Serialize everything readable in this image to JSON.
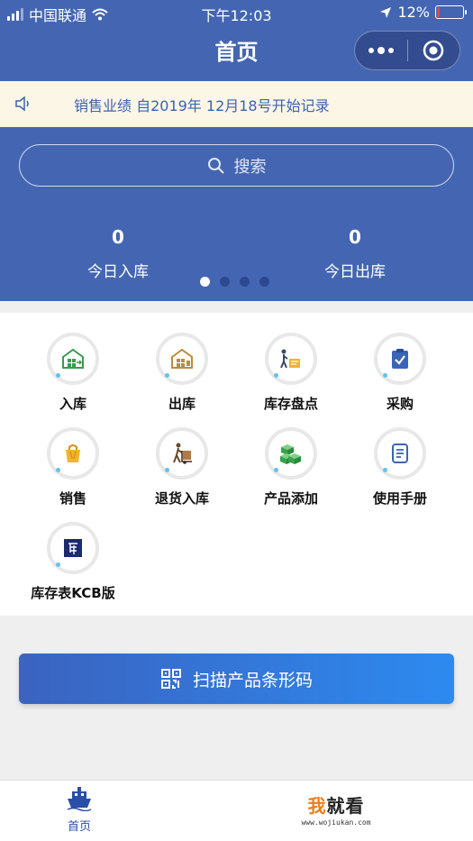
{
  "status_bar": {
    "carrier": "中国联通",
    "time": "下午12:03",
    "battery_percent": "12%",
    "battery_level": 0.12
  },
  "nav": {
    "title": "首页"
  },
  "notice": {
    "text": "销售业绩 自2019年 12月18号开始记录"
  },
  "search": {
    "placeholder": "搜索"
  },
  "stats": [
    {
      "value": "0",
      "label": "今日入库"
    },
    {
      "value": "0",
      "label": "今日出库"
    }
  ],
  "carousel": {
    "count": 4,
    "active": 0
  },
  "menu": {
    "items": [
      {
        "label": "入库",
        "icon": "warehouse-in-icon"
      },
      {
        "label": "出库",
        "icon": "warehouse-out-icon"
      },
      {
        "label": "库存盘点",
        "icon": "inventory-check-icon"
      },
      {
        "label": "采购",
        "icon": "clipboard-check-icon"
      },
      {
        "label": "销售",
        "icon": "shopping-bag-icon"
      },
      {
        "label": "退货入库",
        "icon": "hand-truck-icon"
      },
      {
        "label": "产品添加",
        "icon": "boxes-add-icon"
      },
      {
        "label": "使用手册",
        "icon": "manual-icon"
      },
      {
        "label": "库存表KCB版",
        "icon": "kcb-logo-icon"
      }
    ]
  },
  "scan_button": {
    "label": "扫描产品条形码",
    "icon": "qr-code-icon"
  },
  "tabbar": {
    "home_label": "首页",
    "home_icon": "ship-icon"
  },
  "watermark": {
    "wo": "我",
    "rest": "就看",
    "url": "www.wojiukan.com"
  },
  "colors": {
    "brand_blue": "#4466b2",
    "notice_bg": "#fcf6e6",
    "notice_text": "#3a62b4",
    "battery_low": "#e04646"
  }
}
